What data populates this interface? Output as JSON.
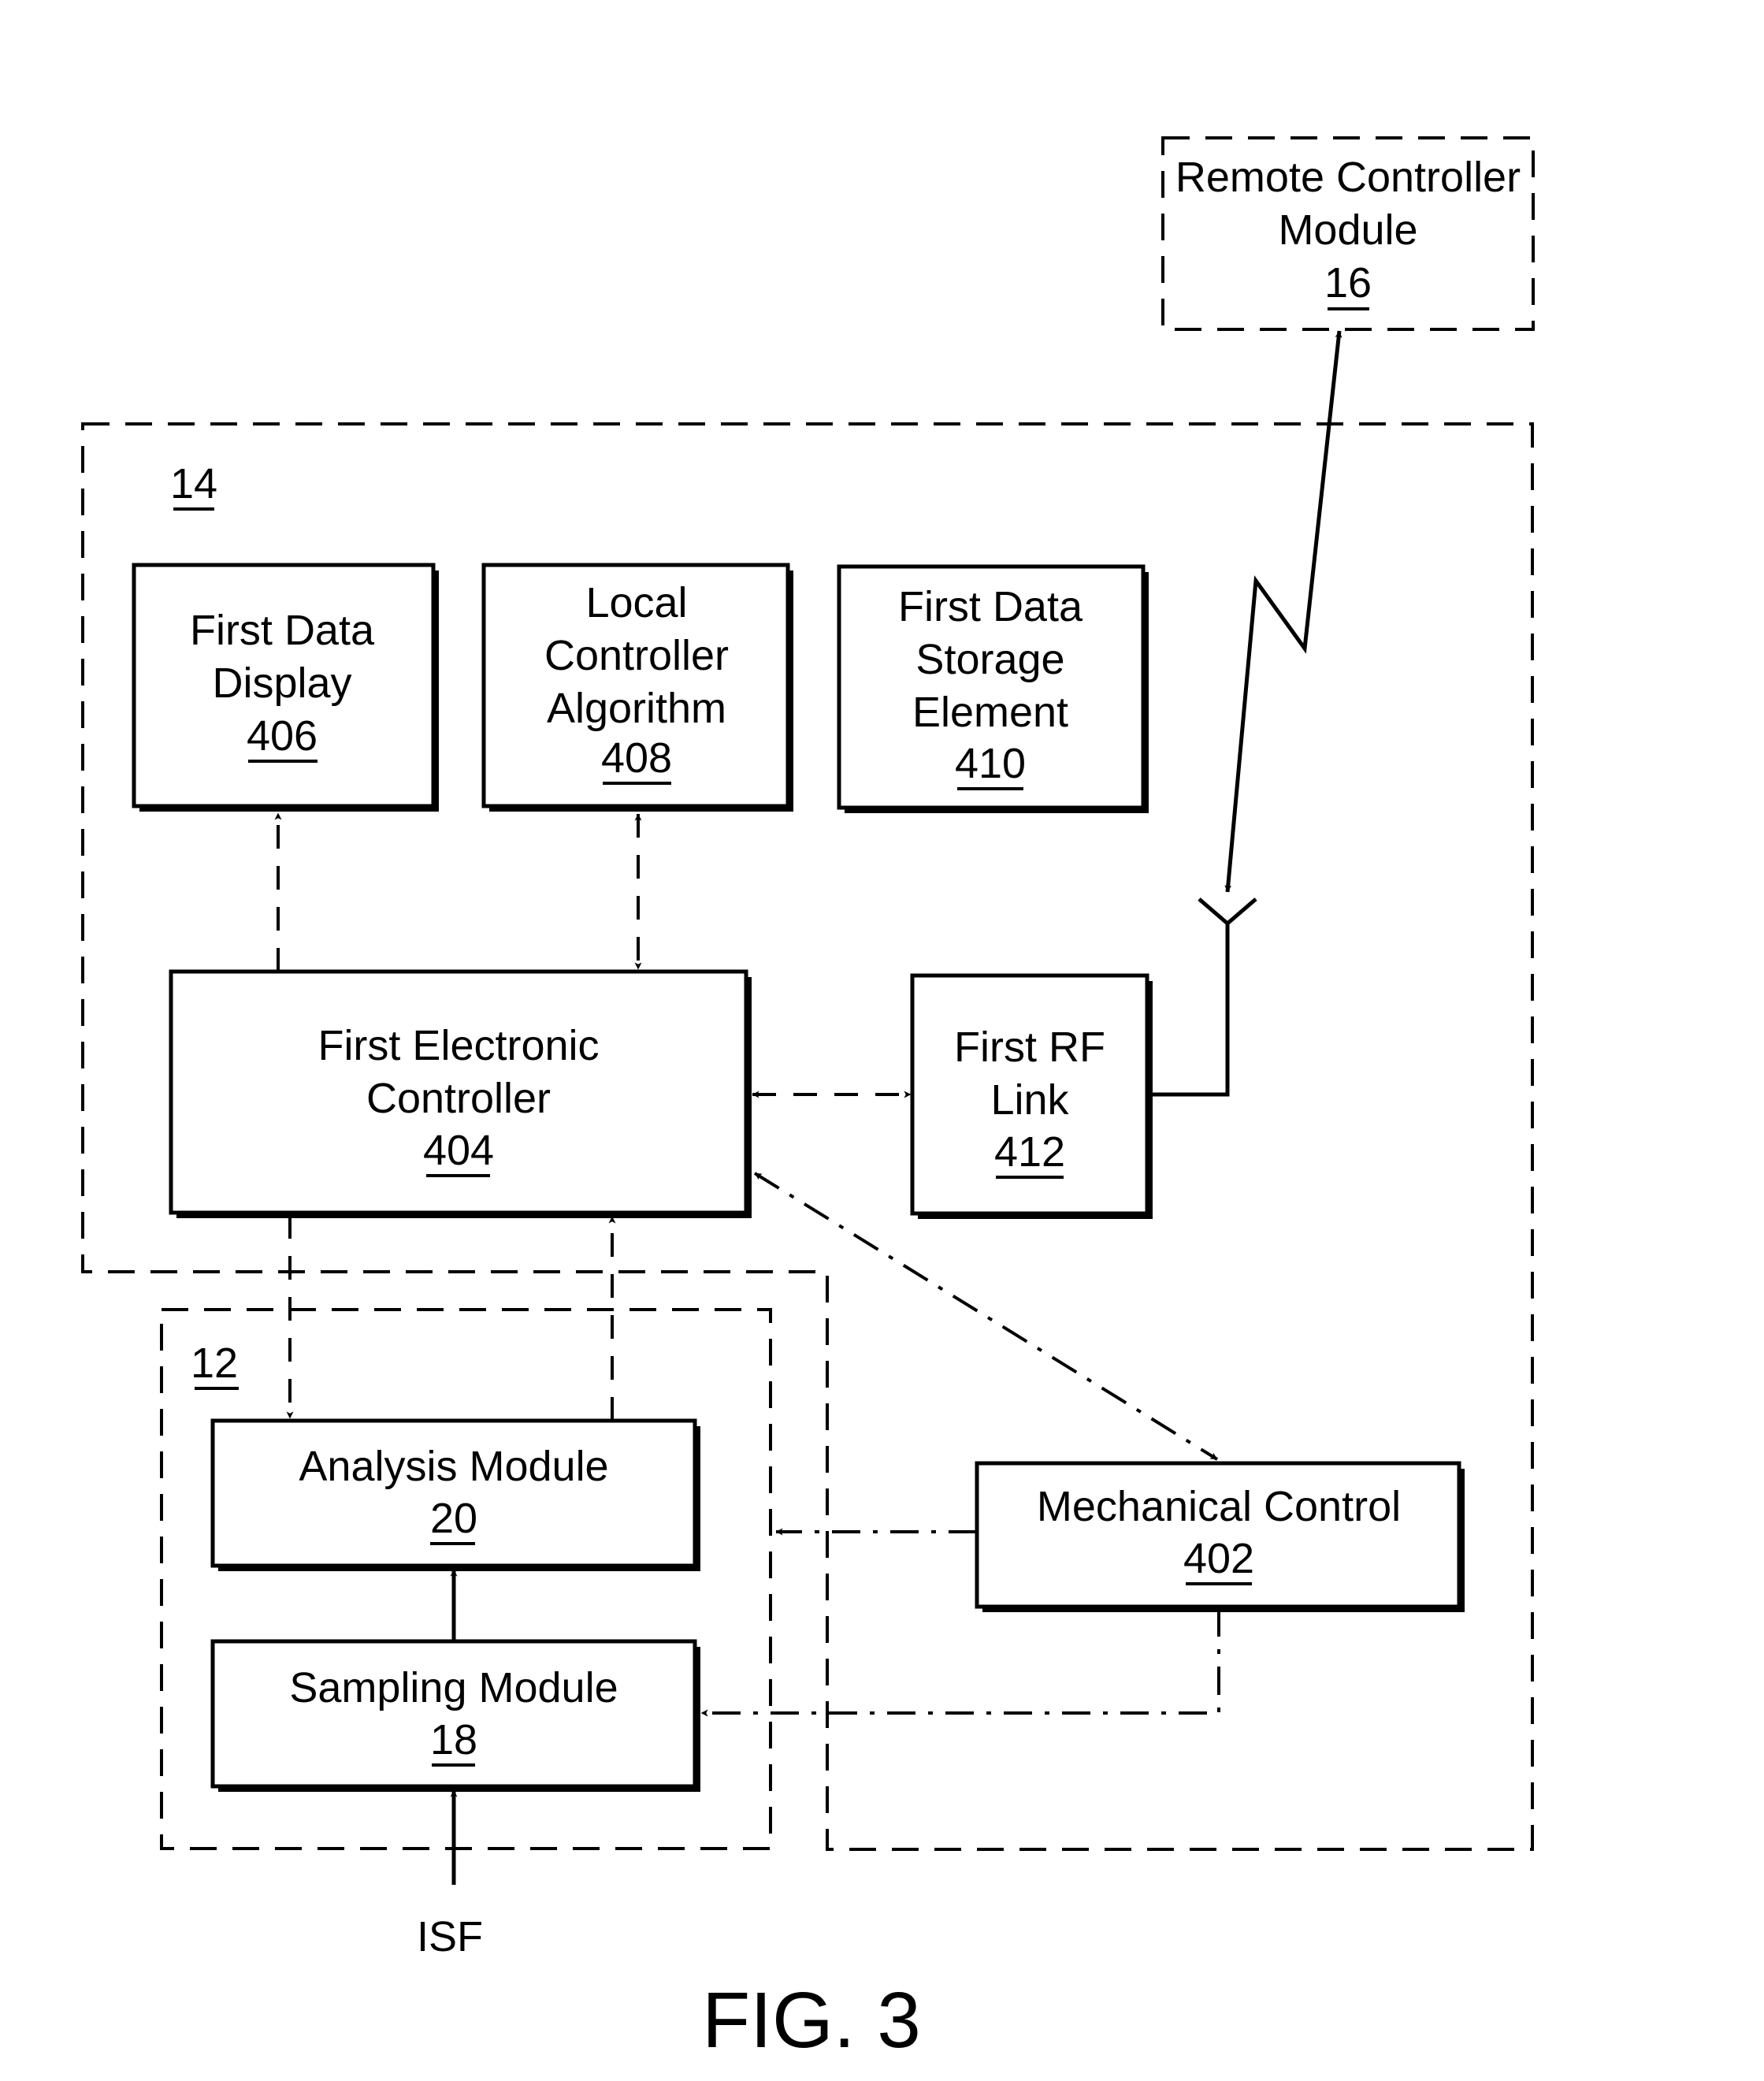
{
  "figure": {
    "caption": "FIG. 3",
    "input_label": "ISF"
  },
  "groups": {
    "device_14": {
      "ref": "14"
    },
    "module_12": {
      "ref": "12"
    }
  },
  "blocks": {
    "remote_controller": {
      "lines": [
        "Remote Controller",
        "Module"
      ],
      "ref": "16"
    },
    "first_data_display": {
      "lines": [
        "First Data",
        "Display"
      ],
      "ref": "406"
    },
    "local_controller_algorithm": {
      "lines": [
        "Local",
        "Controller",
        "Algorithm"
      ],
      "ref": "408"
    },
    "first_data_storage": {
      "lines": [
        "First Data",
        "Storage",
        "Element"
      ],
      "ref": "410"
    },
    "first_electronic_controller": {
      "lines": [
        "First Electronic",
        "Controller"
      ],
      "ref": "404"
    },
    "first_rf_link": {
      "lines": [
        "First RF",
        "Link"
      ],
      "ref": "412"
    },
    "analysis_module": {
      "lines": [
        "Analysis Module"
      ],
      "ref": "20"
    },
    "sampling_module": {
      "lines": [
        "Sampling Module"
      ],
      "ref": "18"
    },
    "mechanical_control": {
      "lines": [
        "Mechanical Control"
      ],
      "ref": "402"
    }
  },
  "connections": [
    {
      "from": "first_electronic_controller",
      "to": "first_data_display",
      "style": "dashed",
      "direction": "one-way"
    },
    {
      "from": "first_electronic_controller",
      "to": "local_controller_algorithm",
      "style": "dashed",
      "direction": "two-way"
    },
    {
      "from": "first_electronic_controller",
      "to": "first_rf_link",
      "style": "dashed",
      "direction": "two-way"
    },
    {
      "from": "first_electronic_controller",
      "to": "mechanical_control",
      "style": "dash-dot",
      "direction": "two-way"
    },
    {
      "from": "first_electronic_controller",
      "to": "analysis_module",
      "style": "dashed",
      "direction": "one-way"
    },
    {
      "from": "analysis_module",
      "to": "first_electronic_controller",
      "style": "dashed",
      "direction": "one-way"
    },
    {
      "from": "sampling_module",
      "to": "analysis_module",
      "style": "solid",
      "direction": "one-way"
    },
    {
      "from": "ISF",
      "to": "sampling_module",
      "style": "solid",
      "direction": "one-way"
    },
    {
      "from": "mechanical_control",
      "to": "module_12",
      "style": "dash-dot",
      "direction": "one-way"
    },
    {
      "from": "mechanical_control",
      "to": "sampling_module",
      "style": "dash-dot",
      "direction": "one-way"
    },
    {
      "from": "first_rf_link",
      "to": "remote_controller",
      "style": "wireless",
      "direction": "two-way"
    }
  ]
}
